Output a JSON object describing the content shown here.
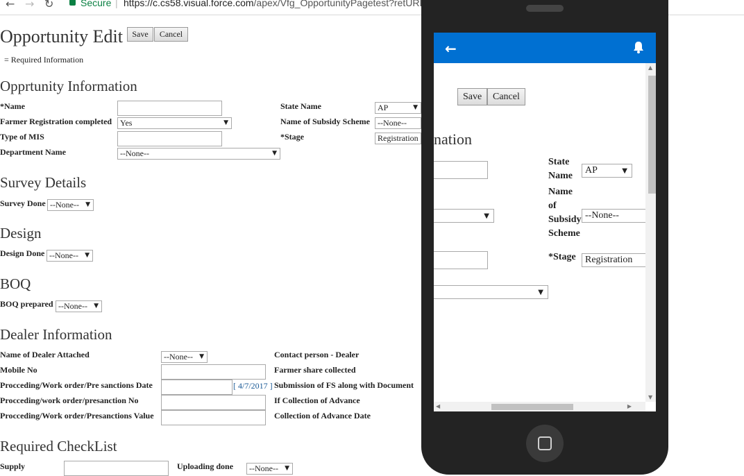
{
  "browser": {
    "secure_label": "Secure",
    "url_host": "https://c.cs58.visual.force.com",
    "url_path": "/apex/Vfg_OpportunityPagetest?retURL="
  },
  "page": {
    "title": "Opportunity Edit",
    "save_label": "Save",
    "cancel_label": "Cancel",
    "required_note": "= Required Information",
    "sections": {
      "opportunity": "Opprtunity Information",
      "survey": "Survey Details",
      "design": "Design",
      "boq": "BOQ",
      "dealer": "Dealer Information",
      "checklist": "Required CheckList"
    },
    "fields": {
      "name": "*Name",
      "farmer_reg": "Farmer Registration completed",
      "farmer_reg_value": "Yes",
      "type_mis": "Type of MIS",
      "department": "Department Name",
      "department_value": "--None--",
      "state_name": "State Name",
      "state_value": "AP",
      "subsidy_scheme": "Name of Subsidy Scheme",
      "subsidy_value": "--None--",
      "stage": "*Stage",
      "stage_value": "Registration",
      "survey_done": "Survey Done",
      "survey_value": "--None--",
      "design_done": "Design Done",
      "design_value": "--None--",
      "boq_prepared": "BOQ prepared",
      "boq_value": "--None--",
      "dealer_attached": "Name of Dealer Attached",
      "dealer_value": "--None--",
      "mobile": "Mobile No",
      "pre_sanction_date": "Procceding/Work order/Pre sanctions Date",
      "date_link": "[ 4/7/2017 ]",
      "presanction_no": "Procceding/work order/presanction No",
      "presanction_value": "Procceding/Work order/Presanctions Value",
      "contact_person": "Contact person - Dealer",
      "farmer_share": "Farmer share collected",
      "submission_fs": "Submission of FS along with Document",
      "if_collection": "If Collection of Advance",
      "collection_date": "Collection of Advance Date",
      "supply": "Supply",
      "uploading_done": "Uploading done",
      "uploading_value": "--None--"
    }
  },
  "mobile": {
    "save_label": "Save",
    "cancel_label": "Cancel",
    "section_fragment": "nation",
    "state_name_line1": "State",
    "state_name_line2": "Name",
    "state_value": "AP",
    "subsidy_line1": "Name",
    "subsidy_line2": "of",
    "subsidy_line3": "Subsidy",
    "subsidy_line4": "Scheme",
    "subsidy_value": "--None--",
    "stage_label": "*Stage",
    "stage_value": "Registration"
  },
  "colors": {
    "appbar": "#0070d2",
    "phone_body": "#232323",
    "secure_green": "#0b8043",
    "link_blue": "#1a5a96"
  }
}
